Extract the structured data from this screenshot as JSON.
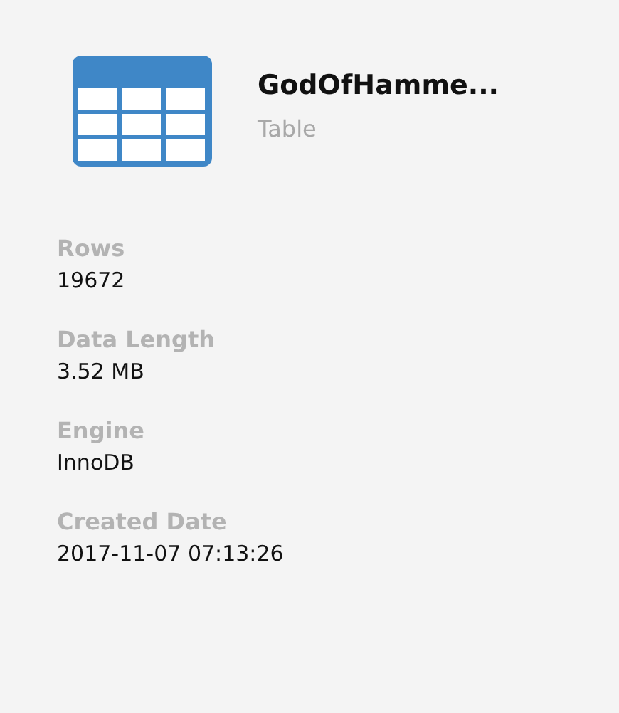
{
  "header": {
    "title": "GodOfHamme...",
    "subtitle": "Table"
  },
  "fields": [
    {
      "label": "Rows",
      "value": "19672"
    },
    {
      "label": "Data Length",
      "value": "3.52 MB"
    },
    {
      "label": "Engine",
      "value": "InnoDB"
    },
    {
      "label": "Created Date",
      "value": "2017-11-07 07:13:26"
    }
  ]
}
